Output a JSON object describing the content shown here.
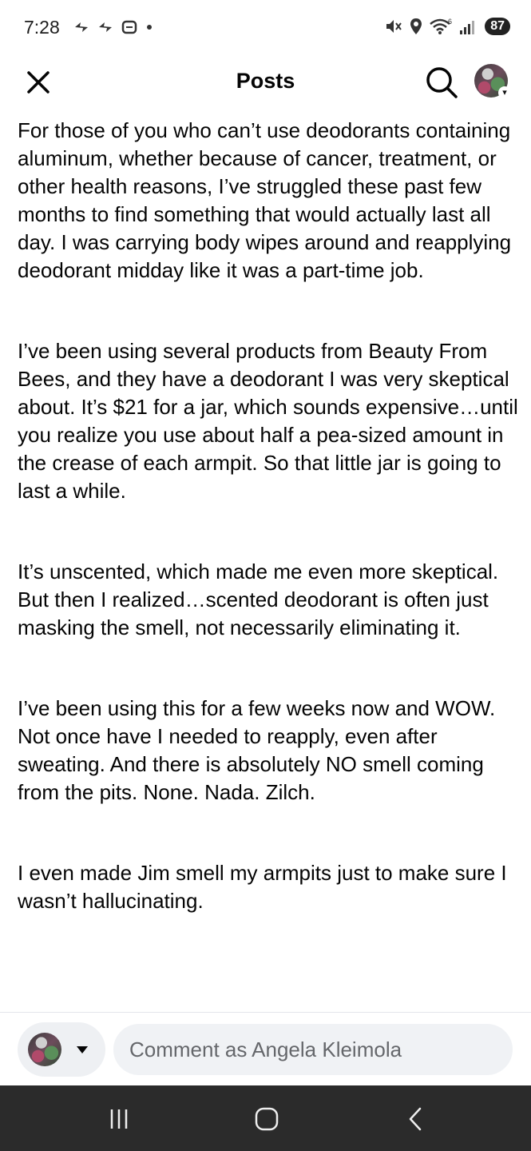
{
  "status_bar": {
    "time": "7:28",
    "battery": "87",
    "signal_label": "6",
    "icons_left": [
      "messenger-icon",
      "messenger-icon",
      "chat-icon",
      "dot-icon"
    ],
    "icons_right": [
      "mute-icon",
      "location-icon",
      "wifi-icon",
      "signal-icon",
      "battery-icon"
    ]
  },
  "header": {
    "title": "Posts",
    "close_icon": "close-icon",
    "search_icon": "search-icon",
    "profile_icon": "profile-avatar"
  },
  "post": {
    "paragraphs": [
      "For those of you who can’t use deodorants containing aluminum, whether because of cancer, treatment, or other health reasons, I’ve struggled these past few months to find something that would actually last all day. I was carrying body wipes around and reapplying deodorant midday like it was a part-time job.",
      "I’ve been using several products from Beauty From Bees, and they have a deodorant I was very skeptical about. It’s $21 for a jar, which sounds expensive…until you realize you use about half a pea-sized amount in the crease of each armpit. So that little jar is going to last a while.",
      "It’s unscented, which made me even more skeptical. But then I realized…scented deodorant is often just masking the smell, not necessarily eliminating it.",
      "I’ve been using this for a few weeks now and WOW. Not once have I needed to reapply, even after sweating. And there is absolutely NO smell coming from the pits. None. Nada. Zilch.",
      "I even made Jim smell my armpits just to make sure I wasn’t hallucinating."
    ]
  },
  "comment_bar": {
    "placeholder": "Comment as Angela Kleimola"
  },
  "colors": {
    "text": "#050505",
    "placeholder": "#65676b",
    "input_bg": "#f0f2f5",
    "nav_bar": "#2b2b2b"
  }
}
